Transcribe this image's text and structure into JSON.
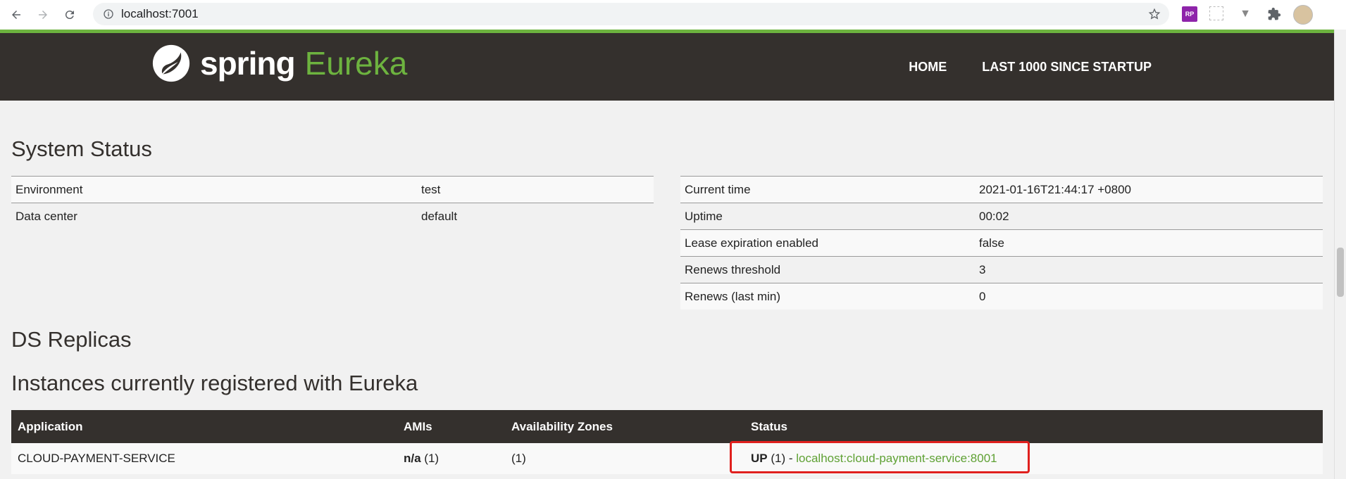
{
  "browser": {
    "url": "localhost:7001"
  },
  "header": {
    "logo_spring": "spring",
    "logo_eureka": "Eureka",
    "nav": [
      {
        "label": "HOME"
      },
      {
        "label": "LAST 1000 SINCE STARTUP"
      }
    ]
  },
  "system_status": {
    "title": "System Status",
    "left": [
      {
        "key": "Environment",
        "value": "test"
      },
      {
        "key": "Data center",
        "value": "default"
      }
    ],
    "right": [
      {
        "key": "Current time",
        "value": "2021-01-16T21:44:17 +0800"
      },
      {
        "key": "Uptime",
        "value": "00:02"
      },
      {
        "key": "Lease expiration enabled",
        "value": "false"
      },
      {
        "key": "Renews threshold",
        "value": "3"
      },
      {
        "key": "Renews (last min)",
        "value": "0"
      }
    ]
  },
  "ds_replicas": {
    "title": "DS Replicas"
  },
  "instances": {
    "title": "Instances currently registered with Eureka",
    "columns": [
      "Application",
      "AMIs",
      "Availability Zones",
      "Status"
    ],
    "rows": [
      {
        "application": "CLOUD-PAYMENT-SERVICE",
        "amis_bold": "n/a",
        "amis_count": " (1)",
        "zones": "(1)",
        "status_bold": "UP",
        "status_count": " (1) - ",
        "status_link": "localhost:cloud-payment-service:8001"
      }
    ]
  },
  "colors": {
    "brand_green": "#6db33f",
    "header_bg": "#34302d",
    "highlight": "#e0201e"
  }
}
